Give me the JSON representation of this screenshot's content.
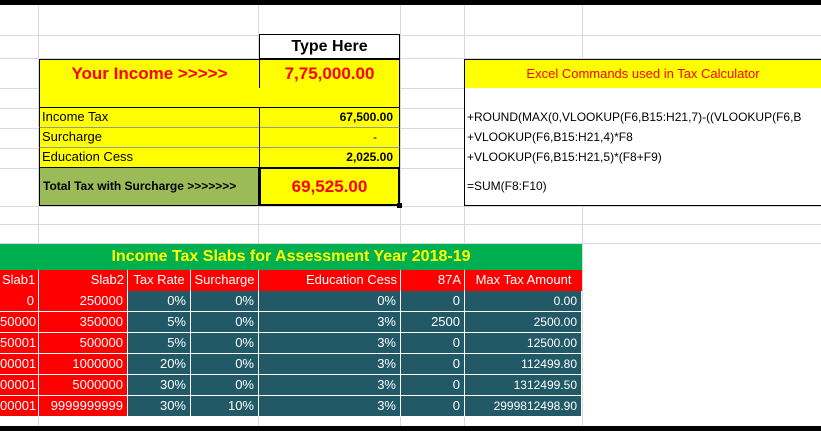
{
  "input": {
    "type_here": "Type Here",
    "your_income_label": "Your Income >>>>>",
    "your_income_value": "7,75,000.00"
  },
  "results": {
    "income_tax_label": "Income Tax",
    "income_tax_value": "67,500.00",
    "surcharge_label": "Surcharge",
    "surcharge_value": "-",
    "education_cess_label": "Education Cess",
    "education_cess_value": "2,025.00",
    "total_label": "Total Tax with Surcharge >>>>>>>",
    "total_value": "69,525.00"
  },
  "commands": {
    "header": "Excel Commands used in Tax Calculator",
    "lines": [
      "+ROUND(MAX(0,VLOOKUP(F6,B15:H21,7)-((VLOOKUP(F6,B",
      "+VLOOKUP(F6,B15:H21,4)*F8",
      "+VLOOKUP(F6,B15:H21,5)*(F8+F9)",
      "=SUM(F8:F10)"
    ]
  },
  "slabs": {
    "title": "Income Tax Slabs for Assessment Year 2018-19",
    "headers": [
      "Slab1",
      "Slab2",
      "Tax Rate",
      "Surcharge",
      "Education Cess",
      "87A",
      "Max Tax Amount"
    ],
    "rows": [
      [
        "0",
        "250000",
        "0%",
        "0%",
        "0%",
        "0",
        "0.00"
      ],
      [
        "50000",
        "350000",
        "5%",
        "0%",
        "3%",
        "2500",
        "2500.00"
      ],
      [
        "50001",
        "500000",
        "5%",
        "0%",
        "3%",
        "0",
        "12500.00"
      ],
      [
        "00001",
        "1000000",
        "20%",
        "0%",
        "3%",
        "0",
        "112499.80"
      ],
      [
        "00001",
        "5000000",
        "30%",
        "0%",
        "3%",
        "0",
        "1312499.50"
      ],
      [
        "00001",
        "9999999999",
        "30%",
        "10%",
        "3%",
        "0",
        "2999812498.90"
      ]
    ]
  },
  "colors": {
    "yellow": "#ffff00",
    "red": "#ff0000",
    "teal": "#215967",
    "green": "#00b050",
    "olive": "#9bbb59"
  }
}
